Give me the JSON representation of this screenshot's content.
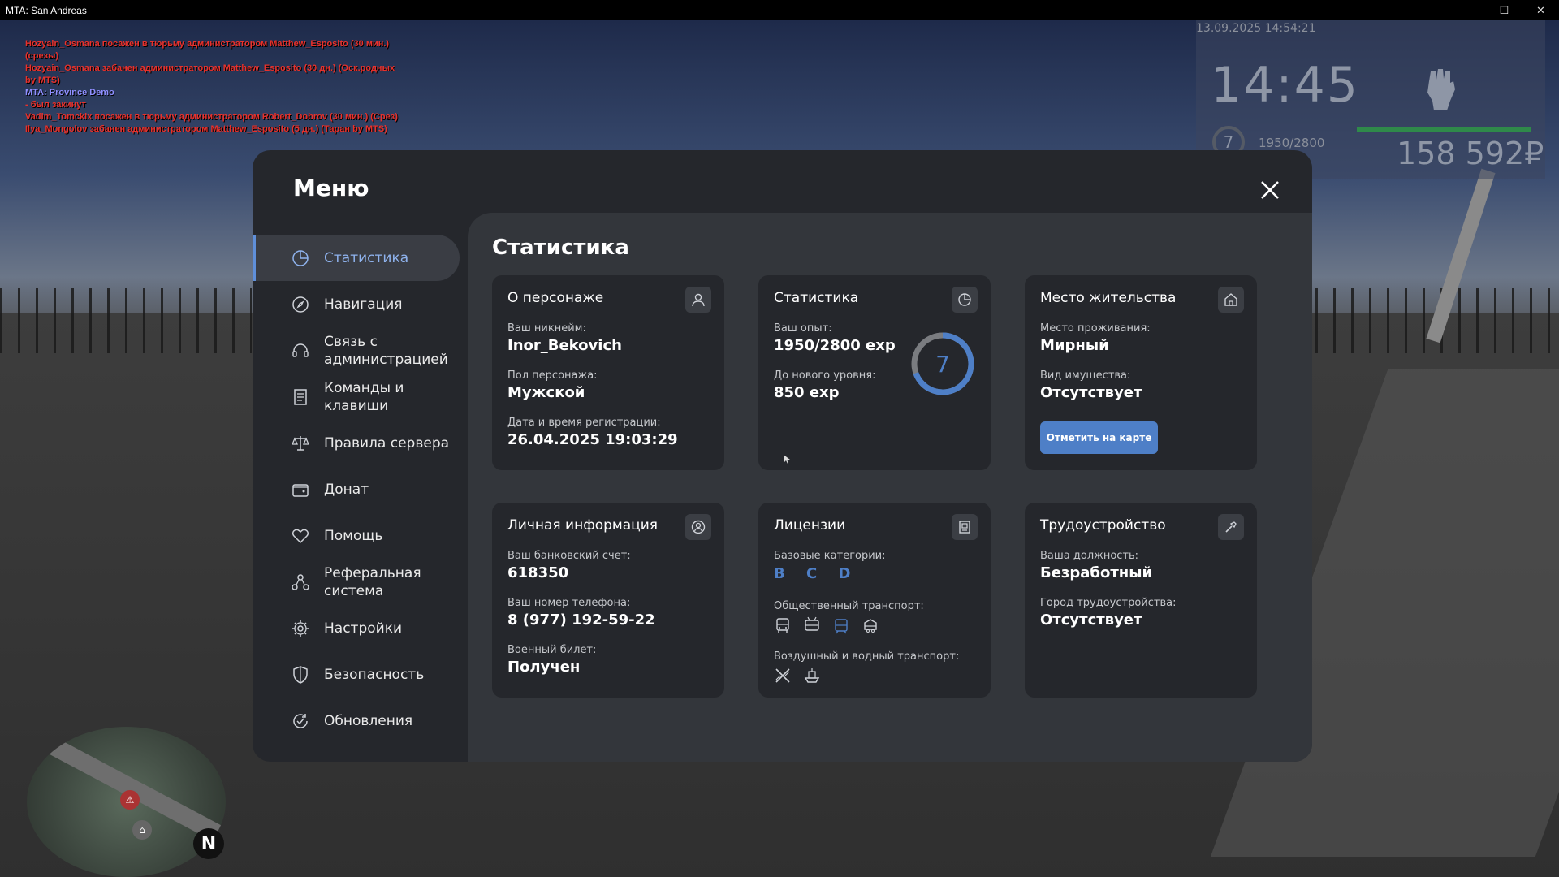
{
  "window": {
    "title": "MTA: San Andreas",
    "controls": {
      "minimize": "—",
      "maximize": "☐",
      "close": "✕"
    }
  },
  "chat": [
    {
      "text": "Hozyain_Osmana посажен в тюрьму администратором Matthew_Esposito (30 мин.) (срезы)",
      "color": "#e8312c"
    },
    {
      "text": "Hozyain_Osmana забанен администратором Matthew_Esposito (30 дн.) (Оск.родных by MTS)",
      "color": "#e8312c"
    },
    {
      "text": "MTA: Province Demo",
      "color": "#8f8fff"
    },
    {
      "text": "- был закинут",
      "color": "#e8312c"
    },
    {
      "text": "Vadim_Tomckix посажен в тюрьму администратором Robert_Dobrov (30 мин.) (Срез)",
      "color": "#e8312c"
    },
    {
      "text": "Ilya_Mongolov забанен администратором Matthew_Esposito (5 дн.) (Таран by MTS)",
      "color": "#e8312c"
    }
  ],
  "hud": {
    "datetime": "13.09.2025 14:54:21",
    "clock": "14:45",
    "level": "7",
    "xp": "1950/2800",
    "money": "158 592₽",
    "health_fraction": 1.0
  },
  "minimap": {
    "north": "N"
  },
  "menu": {
    "title": "Меню",
    "close_icon": "close-icon",
    "sidebar": [
      {
        "label": "Статистика",
        "icon": "statistics-icon",
        "active": true
      },
      {
        "label": "Навигация",
        "icon": "compass-icon",
        "active": false
      },
      {
        "label": "Связь с администрацией",
        "icon": "headset-icon",
        "active": false
      },
      {
        "label": "Команды и клавиши",
        "icon": "document-icon",
        "active": false
      },
      {
        "label": "Правила сервера",
        "icon": "scales-icon",
        "active": false
      },
      {
        "label": "Донат",
        "icon": "wallet-icon",
        "active": false
      },
      {
        "label": "Помощь",
        "icon": "heart-hands-icon",
        "active": false
      },
      {
        "label": "Реферальная система",
        "icon": "referral-icon",
        "active": false
      },
      {
        "label": "Настройки",
        "icon": "gear-icon",
        "active": false
      },
      {
        "label": "Безопасность",
        "icon": "shield-icon",
        "active": false
      },
      {
        "label": "Обновления",
        "icon": "update-icon",
        "active": false
      }
    ]
  },
  "content": {
    "title": "Статистика",
    "character": {
      "title": "О персонаже",
      "nickname_label": "Ваш никнейм:",
      "nickname": "Inor_Bekovich",
      "gender_label": "Пол персонажа:",
      "gender": "Мужской",
      "reg_label": "Дата и время регистрации:",
      "reg": "26.04.2025 19:03:29"
    },
    "stats": {
      "title": "Статистика",
      "xp_label": "Ваш опыт:",
      "xp": "1950/2800 exp",
      "next_label": "До нового уровня:",
      "next": "850 exp",
      "level": "7",
      "progress": 0.696
    },
    "residence": {
      "title": "Место жительства",
      "place_label": "Место проживания:",
      "place": "Мирный",
      "property_label": "Вид имущества:",
      "property": "Отсутствует",
      "button": "Отметить на карте"
    },
    "personal": {
      "title": "Личная информация",
      "bank_label": "Ваш банковский счет:",
      "bank": "618350",
      "phone_label": "Ваш номер телефона:",
      "phone": "8 (977) 192-59-22",
      "military_label": "Военный билет:",
      "military": "Получен"
    },
    "licenses": {
      "title": "Лицензии",
      "base_label": "Базовые категории:",
      "base": "B C D",
      "public_label": "Общественный транспорт:",
      "public_icons": [
        "bus-icon",
        "trolleybus-icon",
        "tram-icon",
        "taxi-icon"
      ],
      "air_label": "Воздушный и водный транспорт:",
      "air_icons": [
        "plane-icon",
        "boat-icon"
      ]
    },
    "job": {
      "title": "Трудоустройство",
      "position_label": "Ваша должность:",
      "position": "Безработный",
      "city_label": "Город трудоустройства:",
      "city": "Отсутствует"
    }
  },
  "colors": {
    "accent": "#4e7fc7",
    "active_text": "#8fb3ee",
    "panel": "#25272c",
    "content": "#33363b",
    "chat_red": "#e8312c"
  }
}
